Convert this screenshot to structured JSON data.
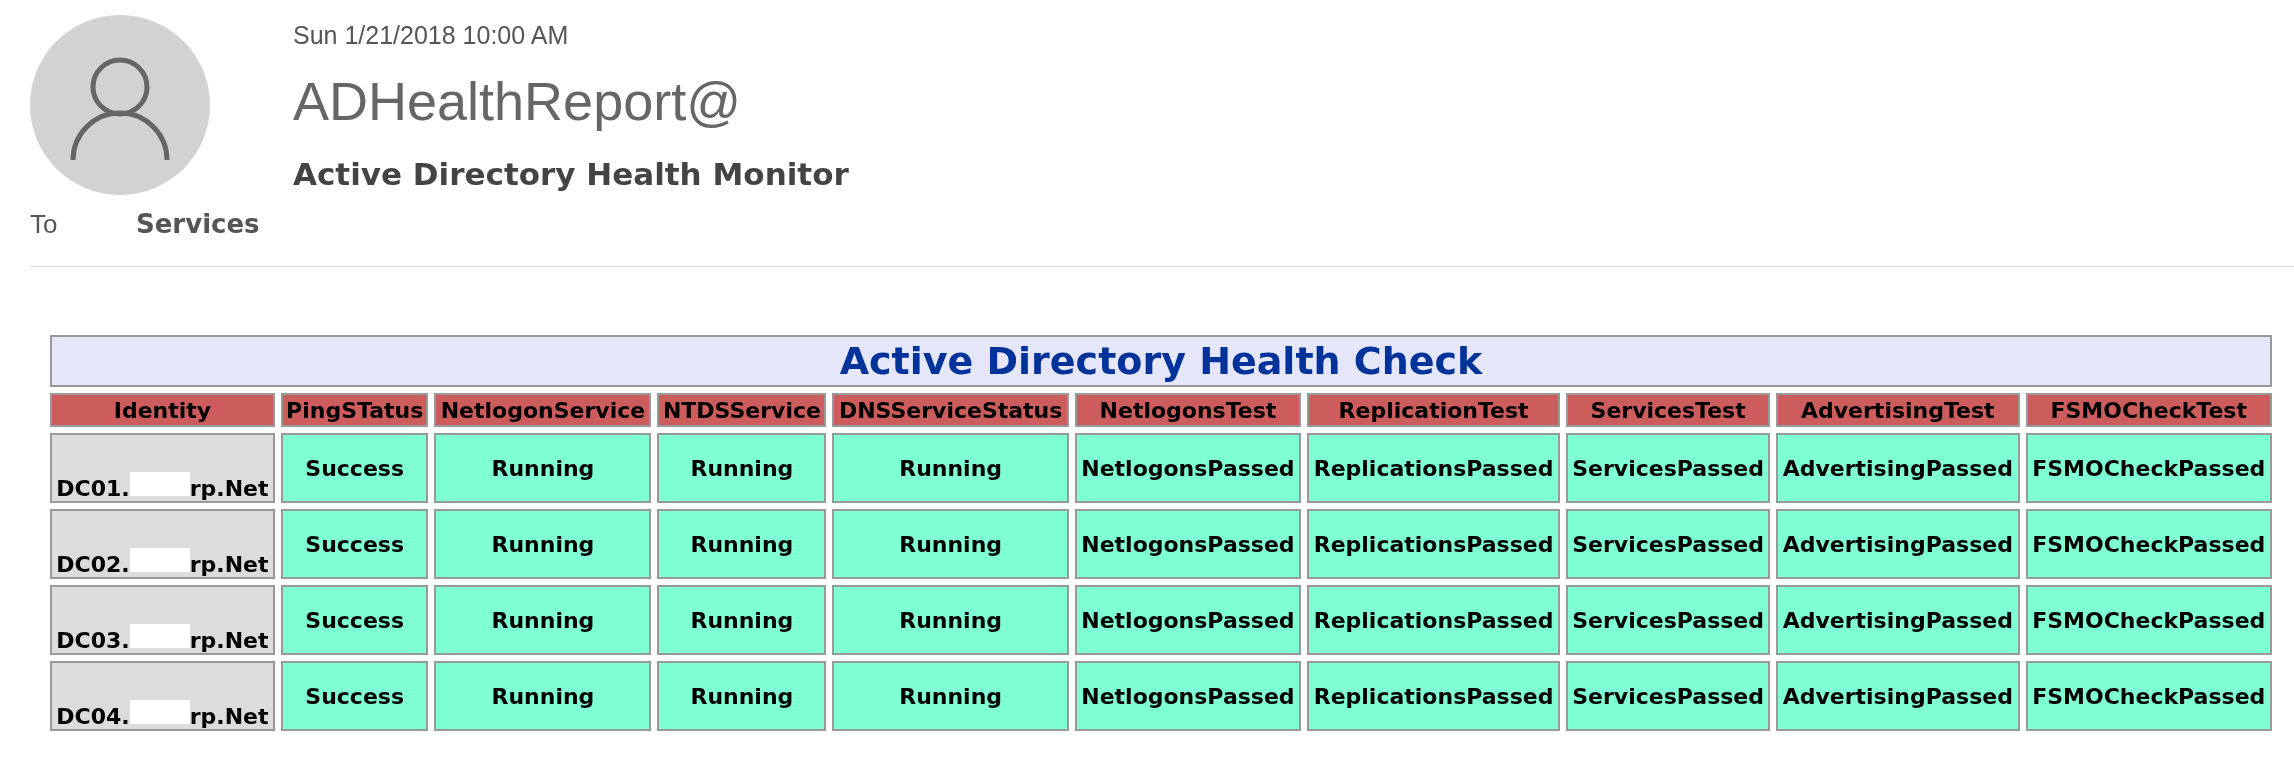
{
  "message": {
    "date": "Sun 1/21/2018 10:00 AM",
    "sender": "ADHealthReport@",
    "subject": "Active Directory Health Monitor",
    "to_label": "To",
    "to": "Services"
  },
  "report": {
    "title": "Active Directory Health Check",
    "columns": [
      "Identity",
      "PingSTatus",
      "NetlogonService",
      "NTDSService",
      "DNSServiceStatus",
      "NetlogonsTest",
      "ReplicationTest",
      "ServicesTest",
      "AdvertisingTest",
      "FSMOCheckTest"
    ],
    "rows": [
      {
        "cells": [
          {
            "start": "DC01.",
            "end": "rp.Net"
          },
          "Success",
          "Running",
          "Running",
          "Running",
          "NetlogonsPassed",
          "ReplicationsPassed",
          "ServicesPassed",
          "AdvertisingPassed",
          "FSMOCheckPassed"
        ]
      },
      {
        "cells": [
          {
            "start": "DC02.",
            "end": "rp.Net"
          },
          "Success",
          "Running",
          "Running",
          "Running",
          "NetlogonsPassed",
          "ReplicationsPassed",
          "ServicesPassed",
          "AdvertisingPassed",
          "FSMOCheckPassed"
        ]
      },
      {
        "cells": [
          {
            "start": "DC03.",
            "end": "rp.Net"
          },
          "Success",
          "Running",
          "Running",
          "Running",
          "NetlogonsPassed",
          "ReplicationsPassed",
          "ServicesPassed",
          "AdvertisingPassed",
          "FSMOCheckPassed"
        ]
      },
      {
        "cells": [
          {
            "start": "DC04.",
            "end": "rp.Net"
          },
          "Success",
          "Running",
          "Running",
          "Running",
          "NetlogonsPassed",
          "ReplicationsPassed",
          "ServicesPassed",
          "AdvertisingPassed",
          "FSMOCheckPassed"
        ]
      }
    ]
  }
}
